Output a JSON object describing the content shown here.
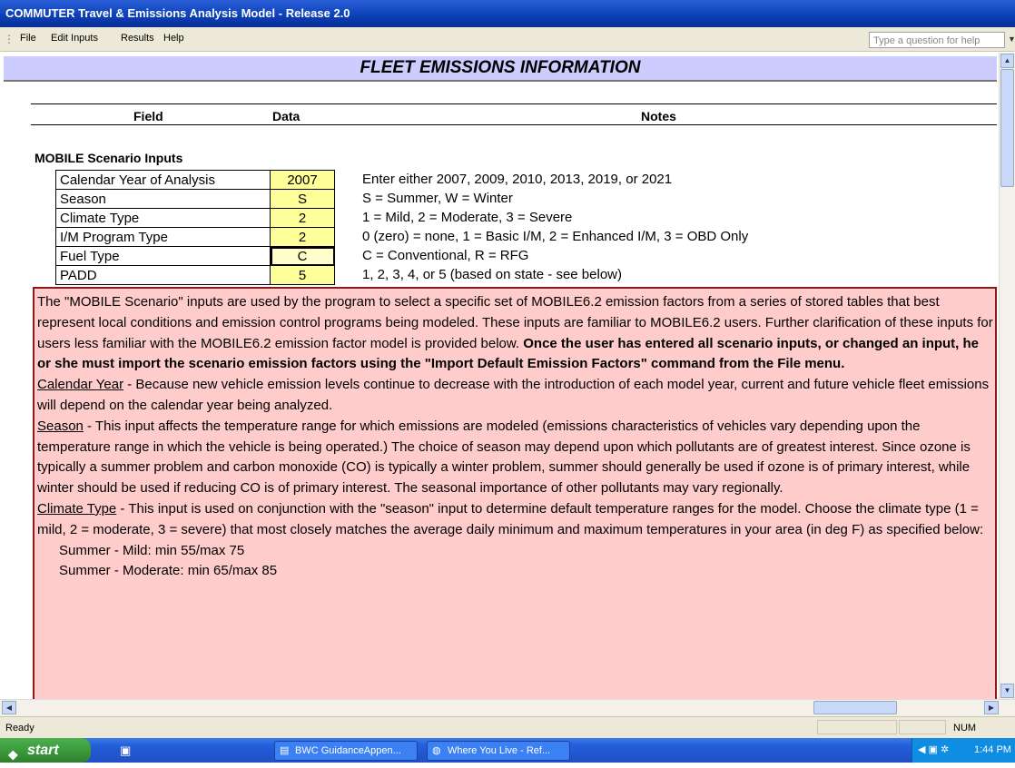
{
  "window": {
    "title": "COMMUTER Travel & Emissions Analysis Model - Release 2.0"
  },
  "menu": {
    "items": [
      {
        "label": "File"
      },
      {
        "label": "Edit Inputs"
      },
      {
        "label": "Results"
      },
      {
        "label": "Help"
      }
    ],
    "help_placeholder": "Type a question for help"
  },
  "sheet": {
    "header": "FLEET EMISSIONS INFORMATION",
    "columns": {
      "field": "Field",
      "data": "Data",
      "notes": "Notes"
    },
    "section_title": "MOBILE Scenario Inputs",
    "rows": [
      {
        "field": "Calendar Year of Analysis",
        "value": "2007",
        "note": "Enter either 2007, 2009, 2010, 2013, 2019, or 2021"
      },
      {
        "field": "Season",
        "value": "S",
        "note": "S = Summer, W = Winter"
      },
      {
        "field": "Climate Type",
        "value": "2",
        "note": "1 = Mild, 2 = Moderate, 3 = Severe"
      },
      {
        "field": "I/M Program Type",
        "value": "2",
        "note": "0 (zero) = none, 1 = Basic I/M, 2 = Enhanced I/M, 3 = OBD Only"
      },
      {
        "field": "Fuel Type",
        "value": "C",
        "note": "C = Conventional, R = RFG"
      },
      {
        "field": "PADD",
        "value": "5",
        "note": "1, 2, 3, 4, or 5 (based on state - see below)"
      }
    ],
    "info": {
      "p1": "The \"MOBILE Scenario\" inputs are used by the program to select a specific set of MOBILE6.2 emission factors from a series of stored tables that best represent local conditions and emission control programs being modeled.  These inputs are familiar to MOBILE6.2 users.  Further clarification of these inputs for users less familiar with the MOBILE6.2 emission factor model is provided below.",
      "p1_bold": "Once the user has entered all scenario inputs, or changed an input, he or she must import the scenario emission factors using the \"Import Default Emission Factors\" command from the File menu.",
      "cal_head": "Calendar Year",
      "cal_text": " - Because new vehicle emission levels continue to decrease with the introduction of each model year, current and future vehicle fleet emissions will depend on the calendar year being analyzed.",
      "season_head": "Season",
      "season_text": " - This input affects the temperature range for which emissions are modeled (emissions characteristics of vehicles vary depending upon the temperature range in which the vehicle is being operated.)  The choice of season may depend upon which pollutants are of greatest interest.  Since ozone is typically a summer problem and carbon monoxide (CO) is typically a winter problem, summer should generally be used if ozone is of primary interest, while winter should be used if reducing CO is of primary interest.  The seasonal importance of other pollutants may vary regionally.",
      "climate_head": "Climate Type",
      "climate_text": " - This input is used on conjunction with the \"season\" input to determine default temperature ranges for the model.  Choose the climate type (1 = mild, 2 = moderate, 3 = severe) that most closely matches the average daily minimum and maximum temperatures in your area (in deg F) as specified below:",
      "s_mild": "Summer - Mild:  min 55/max 75",
      "s_mod": "Summer - Moderate: min 65/max 85"
    }
  },
  "status": {
    "ready": "Ready",
    "num": "NUM"
  },
  "taskbar": {
    "start": "start",
    "items": [
      {
        "label": "BWC GuidanceAppen..."
      },
      {
        "label": "Where You Live - Ref..."
      }
    ],
    "clock": "1:44 PM"
  }
}
